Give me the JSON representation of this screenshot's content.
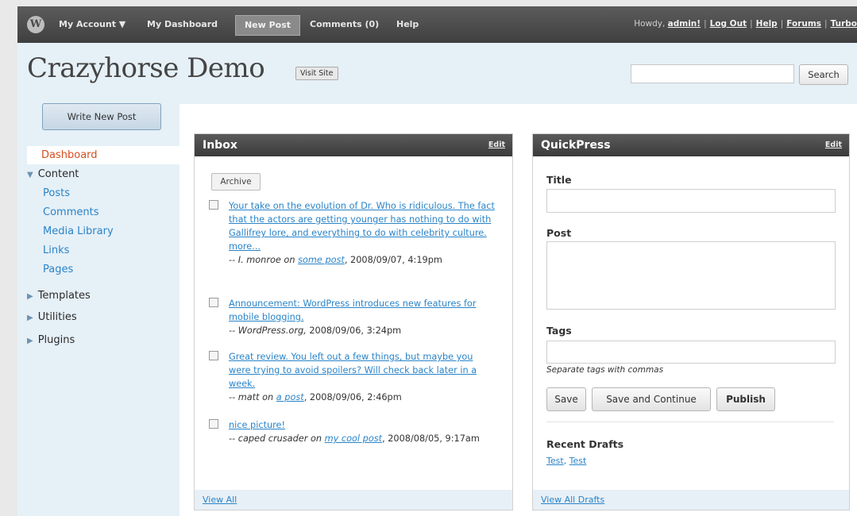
{
  "topbar": {
    "logo": "wordpress-logo",
    "my_account": "My Account ▼",
    "my_dashboard": "My Dashboard",
    "new_post": "New Post",
    "comments": "Comments (0)",
    "help": "Help",
    "howdy_prefix": "Howdy,",
    "user": "admin!",
    "log_out": "Log Out",
    "help_link": "Help",
    "forums": "Forums",
    "turbo": "Turbo"
  },
  "header": {
    "site_title": "Crazyhorse Demo",
    "visit_site": "Visit Site",
    "search_value": "",
    "search_button": "Search"
  },
  "sidebar": {
    "write_new_post": "Write New Post",
    "dashboard": "Dashboard",
    "content": "Content",
    "content_items": [
      "Posts",
      "Comments",
      "Media Library",
      "Links",
      "Pages"
    ],
    "templates": "Templates",
    "utilities": "Utilities",
    "plugins": "Plugins"
  },
  "inbox": {
    "title": "Inbox",
    "edit": "Edit",
    "archive": "Archive",
    "messages": [
      {
        "text": "Your take on the evolution of Dr. Who is ridiculous. The fact that the actors are getting younger has nothing to do with Gallifrey lore, and everything to do with celebrity culture.",
        "more": "more...",
        "author": "-- I. monroe on",
        "post": "some post",
        "date": ", 2008/09/07, 4:19pm"
      },
      {
        "text": "Announcement: WordPress introduces new features for mobile blogging.",
        "author": "-- WordPress.org,",
        "date": " 2008/09/06, 3:24pm"
      },
      {
        "text": "Great review. You left out a few things, but maybe you were trying to avoid spoilers? Will check back later in a week.",
        "author": "-- matt on",
        "post": "a post",
        "date": ", 2008/09/06, 2:46pm"
      },
      {
        "text": "nice picture!",
        "author": "-- caped crusader on",
        "post": "my cool post",
        "date": ", 2008/08/05, 9:17am"
      }
    ],
    "view_all": "View All"
  },
  "quickpress": {
    "title": "QuickPress",
    "edit": "Edit",
    "title_label": "Title",
    "title_value": "",
    "post_label": "Post",
    "post_value": "",
    "tags_label": "Tags",
    "tags_value": "",
    "tags_hint": "Separate tags with commas",
    "save": "Save",
    "save_continue": "Save and Continue",
    "publish": "Publish",
    "recent_drafts": "Recent Drafts",
    "draft1": "Test",
    "draft2": "Test",
    "view_all_drafts": "View All Drafts"
  }
}
